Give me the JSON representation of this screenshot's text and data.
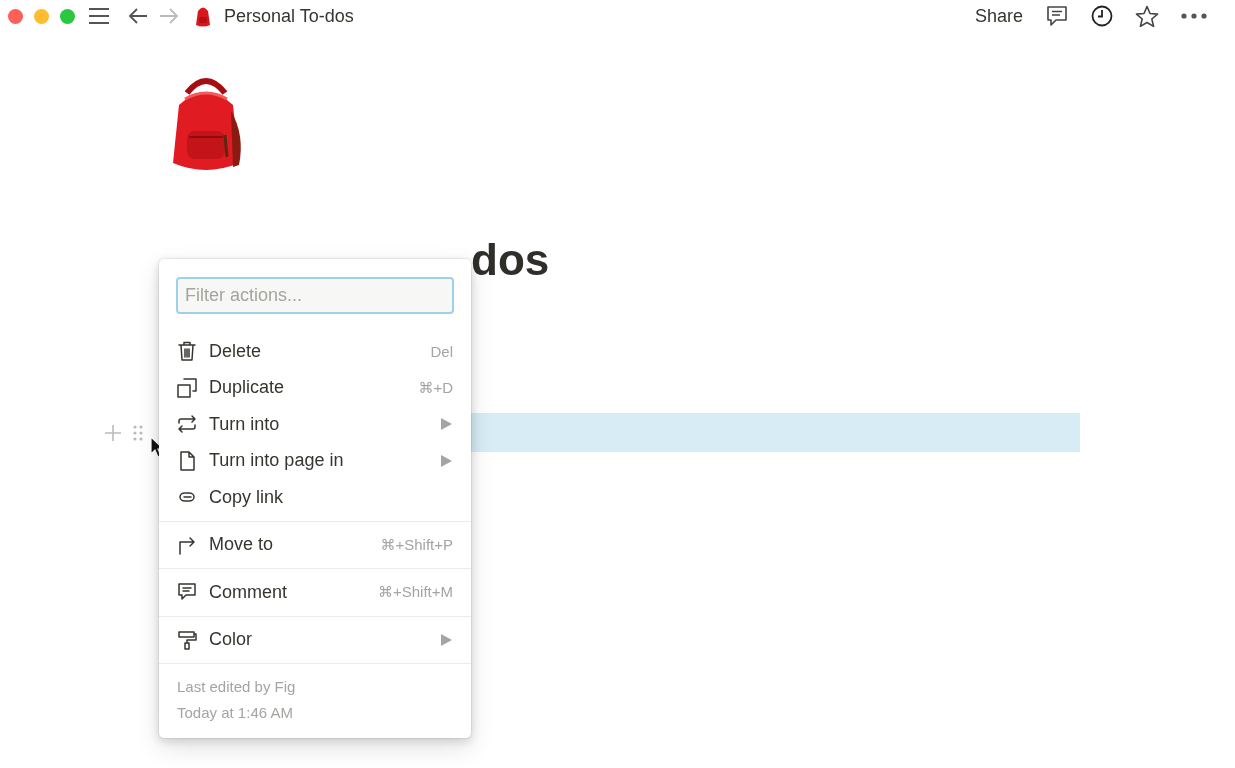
{
  "titlebar": {
    "nav": [
      {
        "disabled": false
      },
      {
        "disabled": true
      }
    ],
    "breadcrumb": "Personal To-dos",
    "share": "Share"
  },
  "page": {
    "title": "dos",
    "block": {
      "selected": true
    }
  },
  "menu": {
    "filter": {
      "placeholder": "Filter actions..."
    },
    "groups": [
      [
        {
          "label": "Delete",
          "shortcut": "Del",
          "submenu": false
        },
        {
          "label": "Duplicate",
          "shortcut": "⌘+D",
          "submenu": false
        },
        {
          "label": "Turn into",
          "submenu": true
        },
        {
          "label": "Turn into page in",
          "submenu": true
        },
        {
          "label": "Copy link",
          "submenu": false
        }
      ],
      [
        {
          "label": "Move to",
          "shortcut": "⌘+Shift+P",
          "submenu": false
        }
      ],
      [
        {
          "label": "Comment",
          "shortcut": "⌘+Shift+M",
          "submenu": false
        }
      ],
      [
        {
          "label": "Color",
          "submenu": true
        }
      ]
    ],
    "footer": [
      "Last edited by Fig",
      "Today at 1:46 AM"
    ]
  }
}
